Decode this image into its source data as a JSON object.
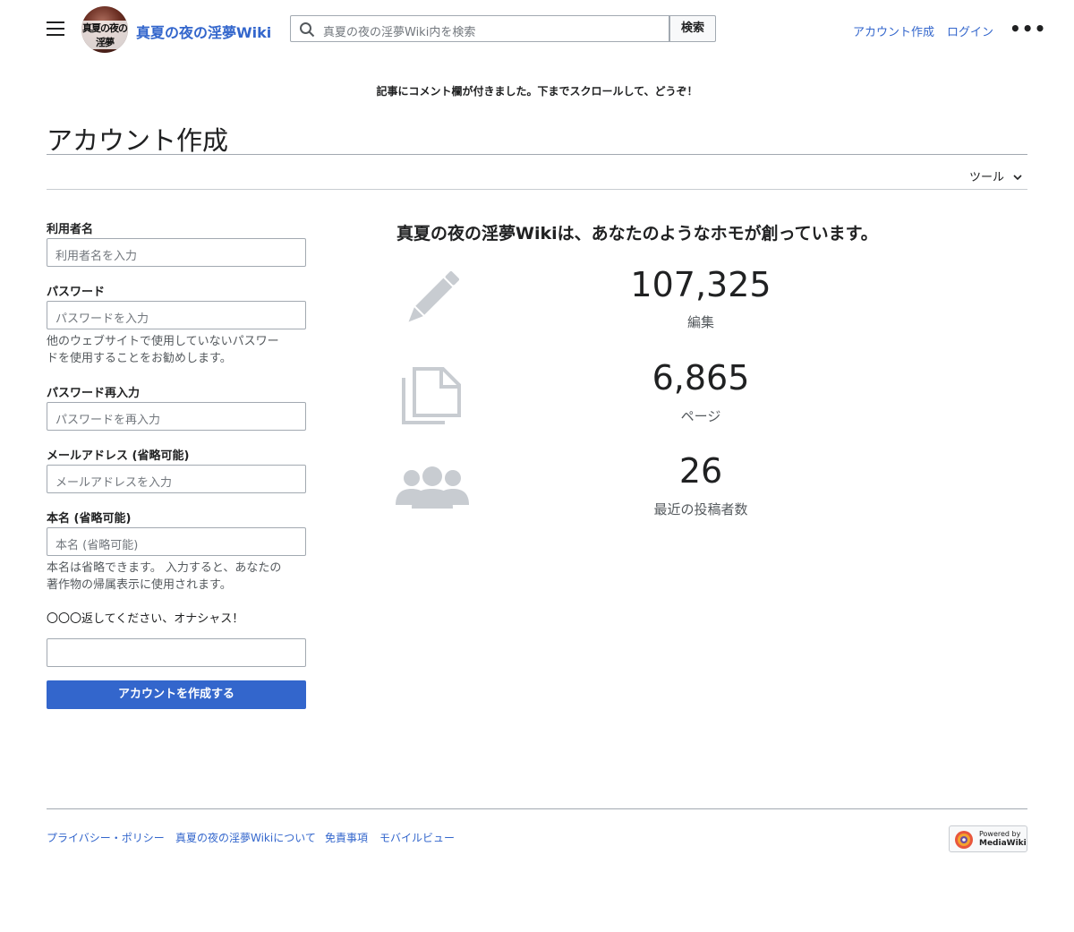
{
  "header": {
    "site_name": "真夏の夜の淫夢Wiki",
    "logo_text": "真夏の夜の淫夢",
    "search_placeholder": "真夏の夜の淫夢Wiki内を検索",
    "search_button": "検索",
    "create_account_link": "アカウント作成",
    "login_link": "ログイン",
    "more_menu": "•••"
  },
  "sitenotice": "記事にコメント欄が付きました。下までスクロールして、どうぞ！",
  "page": {
    "title": "アカウント作成",
    "tools_label": "ツール"
  },
  "form": {
    "username_label": "利用者名",
    "username_placeholder": "利用者名を入力",
    "password_label": "パスワード",
    "password_placeholder": "パスワードを入力",
    "password_help_line1": "他のウェブサイトで使用していないパスワー",
    "password_help_line2": "ドを使用することをお勧めします。",
    "retype_label": "パスワード再入力",
    "retype_placeholder": "パスワードを再入力",
    "email_label": "メールアドレス (省略可能)",
    "email_placeholder": "メールアドレスを入力",
    "realname_label": "本名 (省略可能)",
    "realname_placeholder": "本名 (省略可能)",
    "realname_help_line1": "本名は省略できます。 入力すると、あなたの",
    "realname_help_line2": "著作物の帰属表示に使用されます。",
    "captcha_question": "〇〇〇返してください、オナシャス！",
    "captcha_value": "",
    "submit_label": "アカウントを作成する"
  },
  "stats": {
    "title": "真夏の夜の淫夢Wikiは、あなたのようなホモが創っています。",
    "items": [
      {
        "icon": "pencil-icon",
        "value": "107,325",
        "label": "編集"
      },
      {
        "icon": "pages-icon",
        "value": "6,865",
        "label": "ページ"
      },
      {
        "icon": "users-icon",
        "value": "26",
        "label": "最近の投稿者数"
      }
    ]
  },
  "footer": {
    "links": [
      "プライバシー・ポリシー",
      "真夏の夜の淫夢Wikiについて",
      "免責事項",
      "モバイルビュー"
    ],
    "powered_line1": "Powered by",
    "powered_line2": "MediaWiki"
  },
  "colors": {
    "link": "#3366cc",
    "button": "#3366cc",
    "border": "#a2a9b1",
    "icon": "#c8ccd1"
  }
}
